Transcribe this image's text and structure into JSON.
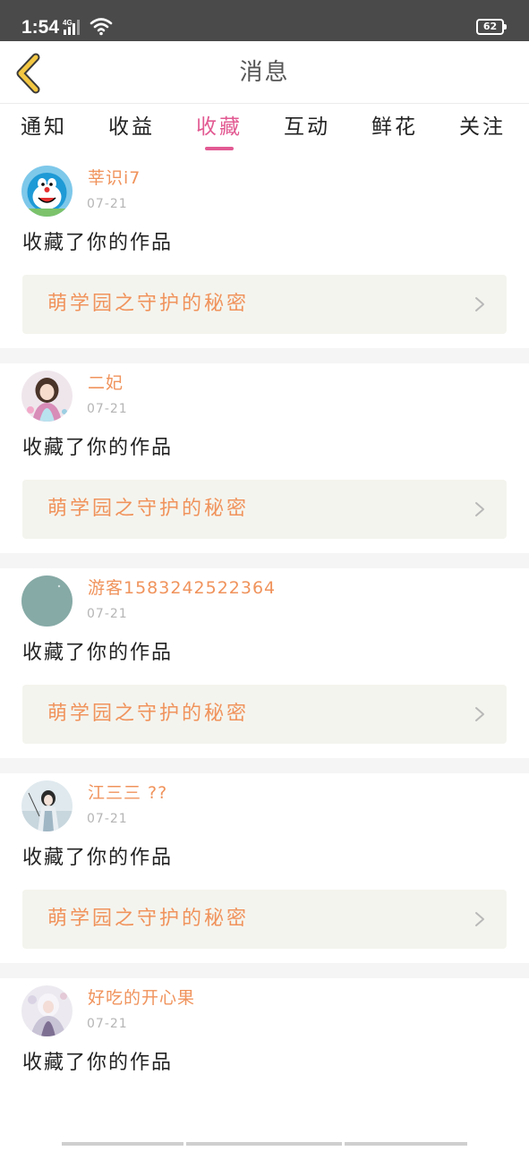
{
  "status_bar": {
    "time": "1:54",
    "network": "4G",
    "battery": "62"
  },
  "header": {
    "title": "消息"
  },
  "tabs": [
    {
      "label": "通知",
      "active": false
    },
    {
      "label": "收益",
      "active": false
    },
    {
      "label": "收藏",
      "active": true
    },
    {
      "label": "互动",
      "active": false
    },
    {
      "label": "鲜花",
      "active": false
    },
    {
      "label": "关注",
      "active": false
    }
  ],
  "colors": {
    "accent": "#e25a92",
    "username": "#f0935c",
    "status_bar": "#4a4a4a",
    "card_link_bg": "#f4f4ee"
  },
  "icons": {
    "back": "chevron-left-icon",
    "link": "chevron-right-icon",
    "signal": "signal-icon",
    "wifi": "wifi-icon",
    "battery": "battery-icon"
  },
  "messages": [
    {
      "username": "莘识i7",
      "date": "07-21",
      "action": "收藏了你的作品",
      "work_title": "萌学园之守护的秘密"
    },
    {
      "username": "二妃",
      "date": "07-21",
      "action": "收藏了你的作品",
      "work_title": "萌学园之守护的秘密"
    },
    {
      "username": "游客1583242522364",
      "date": "07-21",
      "action": "收藏了你的作品",
      "work_title": "萌学园之守护的秘密"
    },
    {
      "username": "江三三 ??",
      "date": "07-21",
      "action": "收藏了你的作品",
      "work_title": "萌学园之守护的秘密"
    },
    {
      "username": "好吃的开心果",
      "date": "07-21",
      "action": "收藏了你的作品",
      "work_title": ""
    }
  ]
}
